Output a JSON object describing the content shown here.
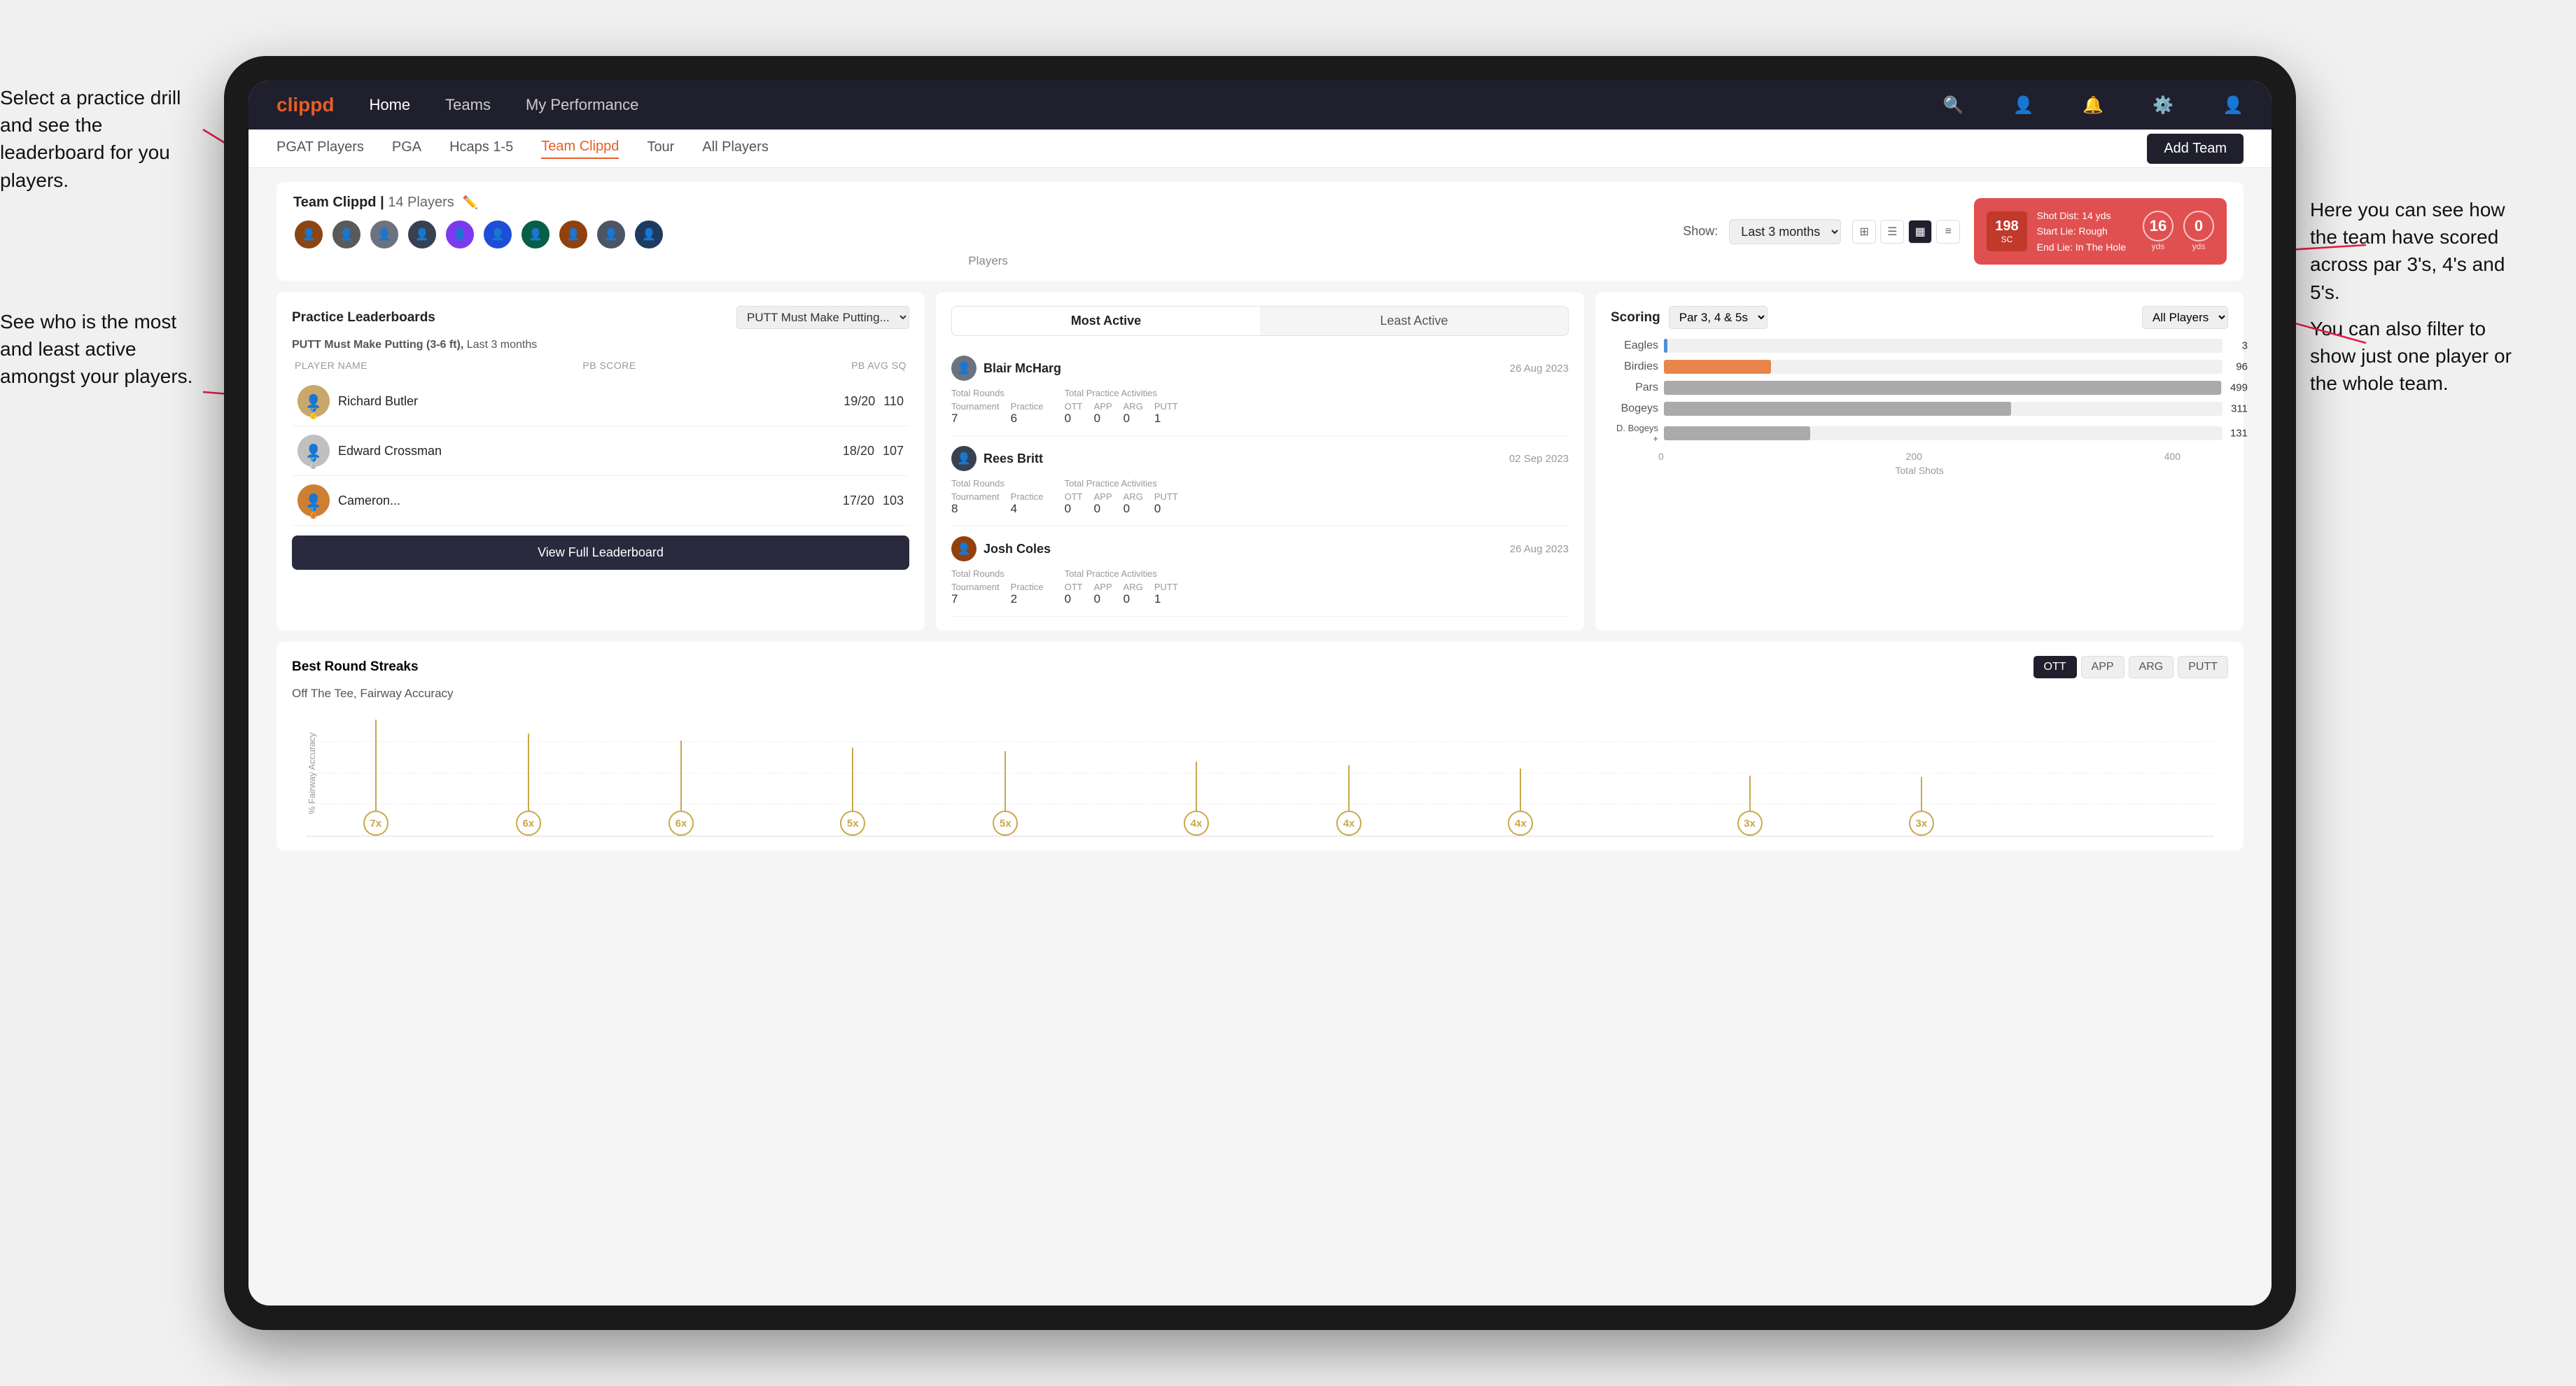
{
  "annotations": {
    "annotation1": "Select a practice drill and see the leaderboard for you players.",
    "annotation2": "See who is the most and least active amongst your players.",
    "annotation3": "Here you can see how the team have scored across par 3's, 4's and 5's.",
    "annotation4": "You can also filter to show just one player or the whole team."
  },
  "nav": {
    "logo": "clippd",
    "items": [
      "Home",
      "Teams",
      "My Performance"
    ],
    "activeItem": "Teams"
  },
  "subNav": {
    "items": [
      "PGAT Players",
      "PGA",
      "Hcaps 1-5",
      "Team Clippd",
      "Tour",
      "All Players"
    ],
    "activeItem": "Team Clippd",
    "addTeamBtn": "Add Team"
  },
  "teamHeader": {
    "title": "Team Clippd",
    "playerCount": "14 Players",
    "showLabel": "Show:",
    "showValue": "Last 3 months",
    "playersLabel": "Players",
    "videoCard": {
      "badge": "198",
      "badgeSub": "SC",
      "shotDist": "Shot Dist: 14 yds",
      "startLie": "Start Lie: Rough",
      "endLie": "End Lie: In The Hole",
      "stat1": {
        "value": "16",
        "label": "yds"
      },
      "stat2": {
        "value": "0",
        "label": "yds"
      }
    }
  },
  "practiceLeaderboards": {
    "title": "Practice Leaderboards",
    "drillSelect": "PUTT Must Make Putting...",
    "subtitle": "PUTT Must Make Putting (3-6 ft),",
    "subtitleSuffix": "Last 3 months",
    "cols": {
      "name": "PLAYER NAME",
      "score": "PB SCORE",
      "avg": "PB AVG SQ"
    },
    "rows": [
      {
        "name": "Richard Butler",
        "score": "19/20",
        "avg": "110",
        "medal": "🥇",
        "rank": 1
      },
      {
        "name": "Edward Crossman",
        "score": "18/20",
        "avg": "107",
        "medal": "🥈",
        "rank": 2
      },
      {
        "name": "Cameron...",
        "score": "17/20",
        "avg": "103",
        "medal": "🥉",
        "rank": 3
      }
    ],
    "viewBtn": "View Full Leaderboard"
  },
  "mostActive": {
    "tabs": [
      "Most Active",
      "Least Active"
    ],
    "activeTab": "Most Active",
    "players": [
      {
        "name": "Blair McHarg",
        "date": "26 Aug 2023",
        "totalRoundsLabel": "Total Rounds",
        "tournament": "7",
        "practice": "6",
        "practiceActivitiesLabel": "Total Practice Activities",
        "ott": "0",
        "app": "0",
        "arg": "0",
        "putt": "1"
      },
      {
        "name": "Rees Britt",
        "date": "02 Sep 2023",
        "totalRoundsLabel": "Total Rounds",
        "tournament": "8",
        "practice": "4",
        "practiceActivitiesLabel": "Total Practice Activities",
        "ott": "0",
        "app": "0",
        "arg": "0",
        "putt": "0"
      },
      {
        "name": "Josh Coles",
        "date": "26 Aug 2023",
        "totalRoundsLabel": "Total Rounds",
        "tournament": "7",
        "practice": "2",
        "practiceActivitiesLabel": "Total Practice Activities",
        "ott": "0",
        "app": "0",
        "arg": "0",
        "putt": "1"
      }
    ]
  },
  "scoring": {
    "title": "Scoring",
    "parFilter": "Par 3, 4 & 5s",
    "playerFilter": "All Players",
    "bars": [
      {
        "label": "Eagles",
        "value": 3,
        "max": 500,
        "color": "#4a90d9"
      },
      {
        "label": "Birdies",
        "value": 96,
        "max": 500,
        "color": "#e8854a"
      },
      {
        "label": "Pars",
        "value": 499,
        "max": 500,
        "color": "#999"
      },
      {
        "label": "Bogeys",
        "value": 311,
        "max": 500,
        "color": "#bbb"
      },
      {
        "label": "D. Bogeys +",
        "value": 131,
        "max": 500,
        "color": "#ccc"
      }
    ],
    "xLabels": [
      "0",
      "200",
      "400"
    ],
    "xTitle": "Total Shots"
  },
  "bestRoundStreaks": {
    "title": "Best Round Streaks",
    "subtitle": "Off The Tee, Fairway Accuracy",
    "tabs": [
      "OTT",
      "APP",
      "ARG",
      "PUTT"
    ],
    "activeTab": "OTT",
    "pins": [
      {
        "label": "7x",
        "height": 130,
        "x": 5
      },
      {
        "label": "6x",
        "height": 110,
        "x": 12
      },
      {
        "label": "6x",
        "height": 100,
        "x": 19
      },
      {
        "label": "5x",
        "height": 90,
        "x": 27
      },
      {
        "label": "5x",
        "height": 85,
        "x": 34
      },
      {
        "label": "4x",
        "height": 70,
        "x": 44
      },
      {
        "label": "4x",
        "height": 65,
        "x": 52
      },
      {
        "label": "4x",
        "height": 60,
        "x": 60
      },
      {
        "label": "3x",
        "height": 50,
        "x": 72
      },
      {
        "label": "3x",
        "height": 48,
        "x": 80
      }
    ]
  }
}
